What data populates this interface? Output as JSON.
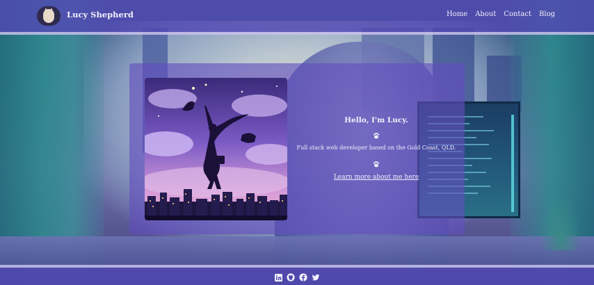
{
  "site": {
    "title": "Lucy Shepherd"
  },
  "nav": {
    "items": [
      {
        "label": "Home"
      },
      {
        "label": "About"
      },
      {
        "label": "Contact"
      },
      {
        "label": "Blog"
      }
    ]
  },
  "hero": {
    "greeting": "Hello, I'm Lucy.",
    "tagline": "Full stack web developer based on the Gold Coast, QLD.",
    "link_text": "Learn more about me here",
    "divider_icon": "paw-icon",
    "image_icon": "dreamer-cats-illustration"
  },
  "footer": {
    "social": [
      {
        "icon": "linkedin-icon"
      },
      {
        "icon": "github-icon"
      },
      {
        "icon": "facebook-icon"
      },
      {
        "icon": "twitter-icon"
      }
    ]
  },
  "colors": {
    "header_bg": "#5248b2",
    "card_bg": "#624ebe",
    "text": "#f4f1fb",
    "rule": "#c8c0eb"
  }
}
